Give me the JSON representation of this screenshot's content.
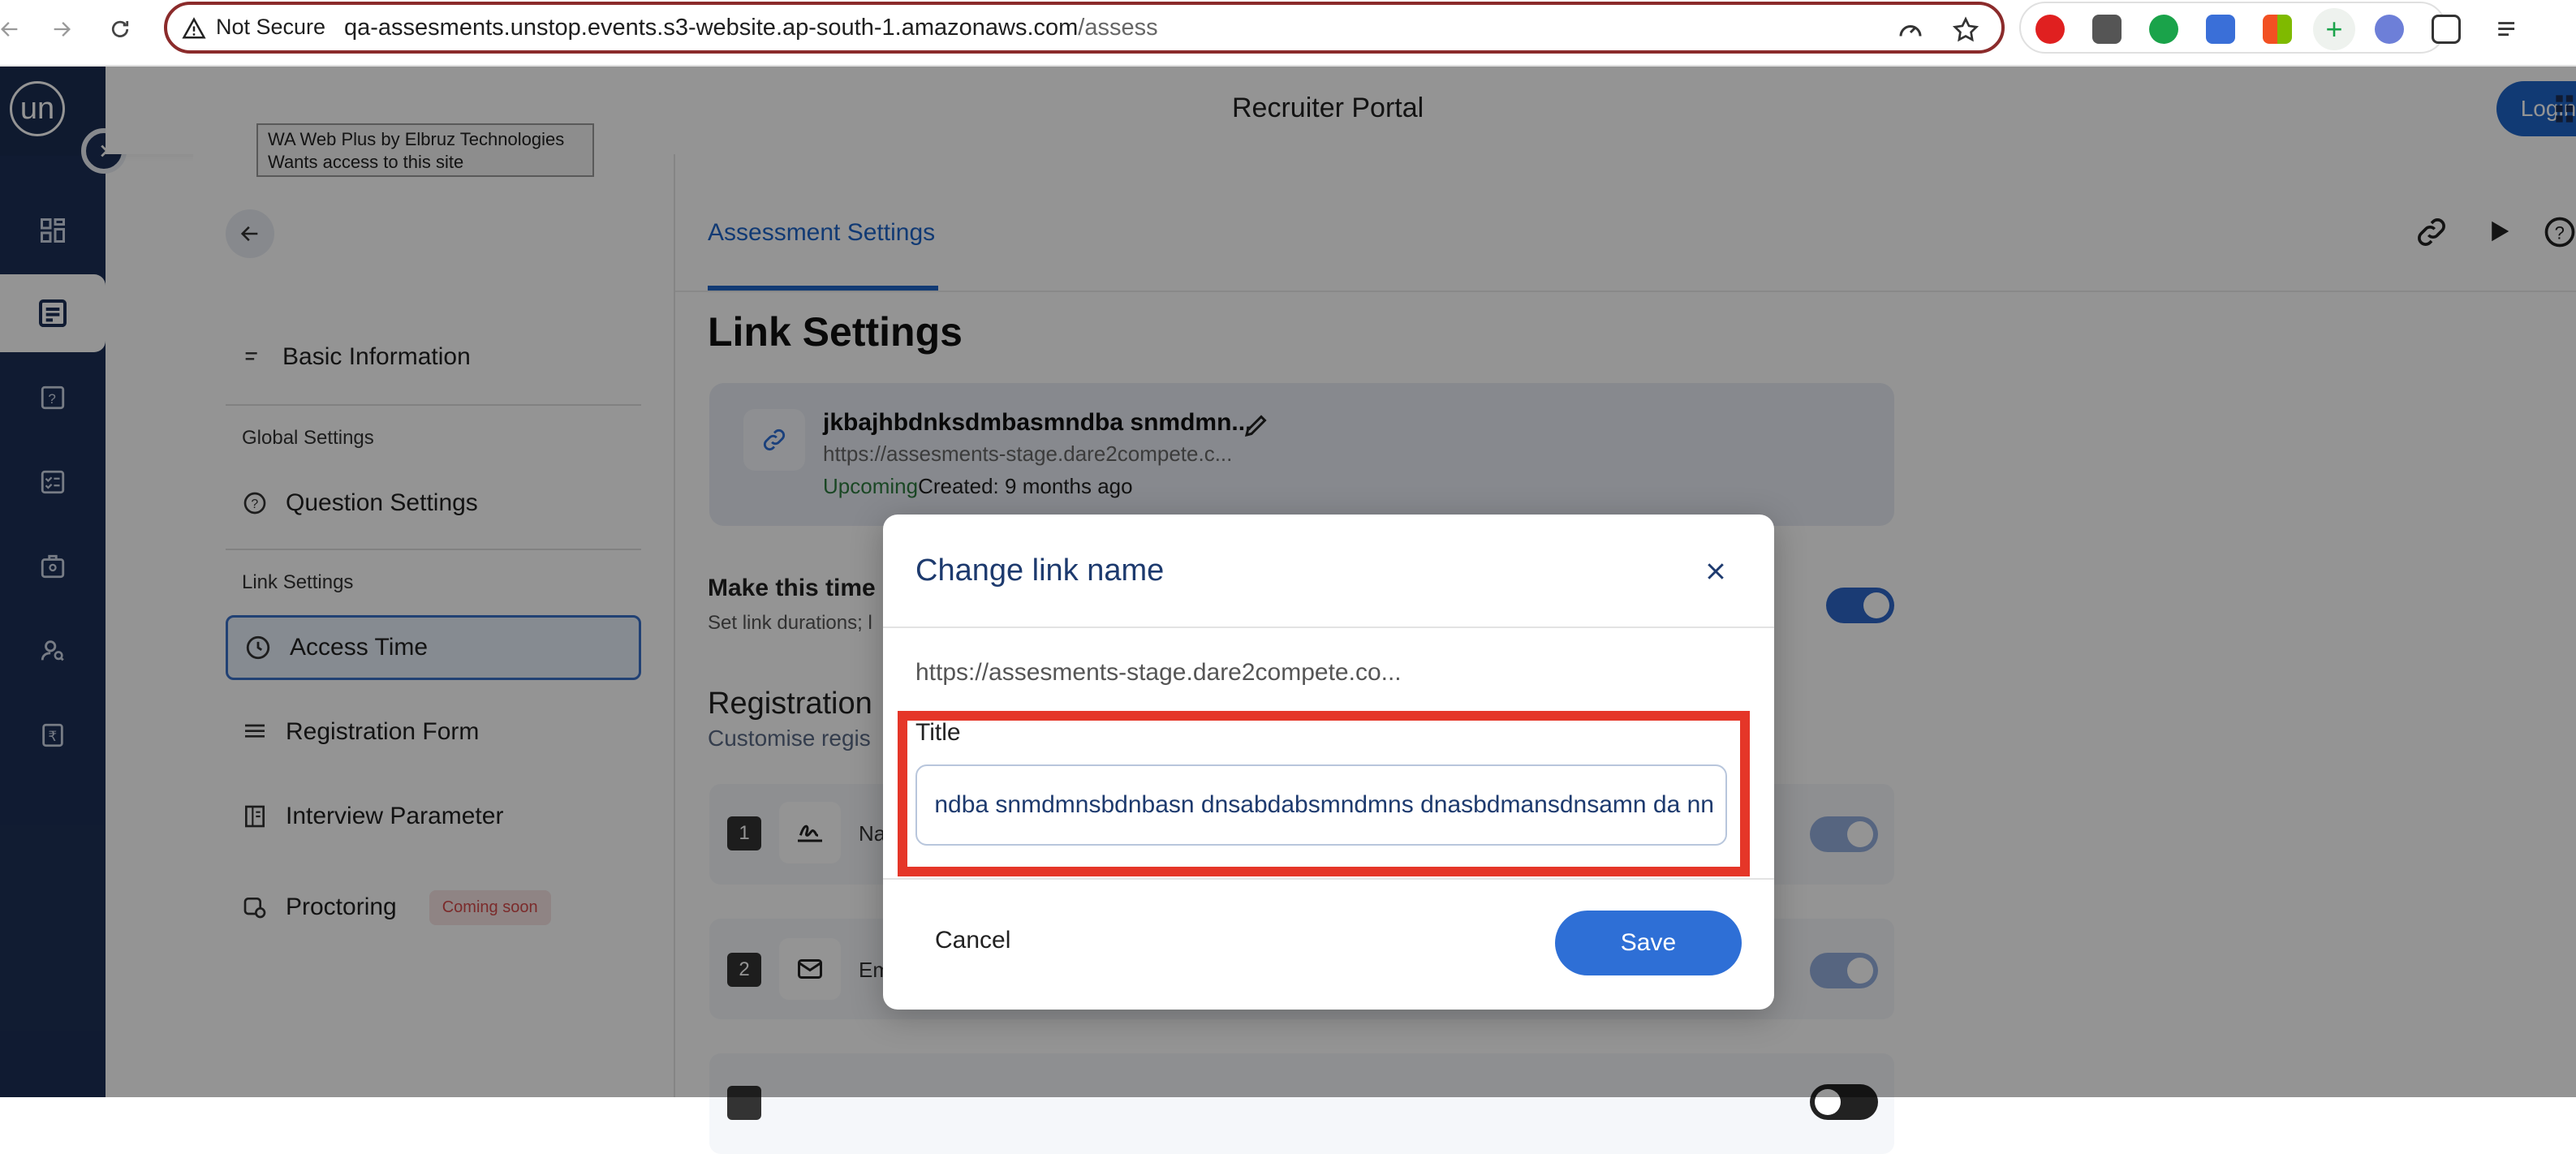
{
  "browser": {
    "security_label": "Not Secure",
    "url_host": "qa-assesments.unstop.events.s3-website.ap-south-1.amazonaws.com",
    "url_path": "/assess"
  },
  "app": {
    "logo_text": "un",
    "header_title": "Recruiter Portal",
    "login_label": "Login"
  },
  "tooltip": {
    "line1": "WA Web Plus by Elbruz Technologies",
    "line2": "Wants access to this site"
  },
  "sidebar": {
    "basic_info": "Basic Information",
    "group_global": "Global Settings",
    "question_settings": "Question Settings",
    "group_link": "Link Settings",
    "access_time": "Access Time",
    "registration_form": "Registration Form",
    "interview_parameter": "Interview Parameter",
    "proctoring": "Proctoring",
    "coming_soon": "Coming soon"
  },
  "main": {
    "tab_label": "Assessment Settings",
    "page_title": "Link Settings",
    "card": {
      "name": "jkbajhbdnksdmbasmndba snmdmn...",
      "url": "https://assesments-stage.dare2compete.c...",
      "status": "Upcoming",
      "created_label": "Created:",
      "created_value": "9 months ago"
    },
    "time_section_title": "Make this time s",
    "time_section_sub": "Set link durations; l",
    "registration_title": "Registration",
    "registration_sub": "Customise regis",
    "rows": [
      {
        "num": "1",
        "label": "Na"
      },
      {
        "num": "2",
        "label": "Em"
      }
    ]
  },
  "modal": {
    "title": "Change link name",
    "url": "https://assesments-stage.dare2compete.co...",
    "field_label": "Title",
    "field_value": "ndba snmdmnsbdnbasn dnsabdabsmndmns dnasbdmansdnsamn da nn",
    "cancel_label": "Cancel",
    "save_label": "Save"
  },
  "colors": {
    "rail": "#1d3057",
    "accent": "#1e64c8",
    "highlight": "#e53628"
  }
}
